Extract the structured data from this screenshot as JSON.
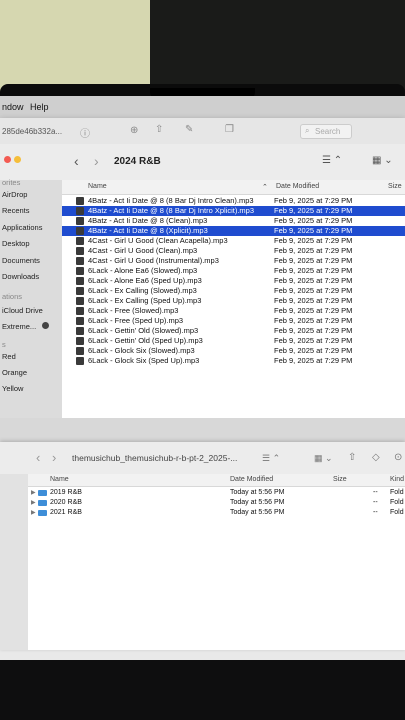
{
  "menubar": {
    "app_item": "ndow",
    "help": "Help"
  },
  "window1": {
    "address_text": "285de46b332a...",
    "search_placeholder": "Search",
    "folder_title": "2024 R&B",
    "sidebar": [
      {
        "label": "orites"
      },
      {
        "label": "AirDrop"
      },
      {
        "label": "Recents"
      },
      {
        "label": "Applications"
      },
      {
        "label": "Desktop"
      },
      {
        "label": "Documents"
      },
      {
        "label": "Downloads"
      },
      {
        "label": "ations"
      },
      {
        "label": "iCloud Drive"
      },
      {
        "label": "Extreme..."
      },
      {
        "label": "s"
      },
      {
        "label": "Red"
      },
      {
        "label": "Orange"
      },
      {
        "label": "Yellow"
      }
    ],
    "columns": {
      "name": "Name",
      "date": "Date Modified",
      "size": "Size"
    },
    "files": [
      {
        "name": "4Batz - Act Ii Date @ 8 (8 Bar Dj Intro Clean).mp3",
        "date": "Feb 9, 2025 at 7:29 PM",
        "selected": false
      },
      {
        "name": "4Batz - Act Ii Date @ 8 (8 Bar Dj Intro Xplicit).mp3",
        "date": "Feb 9, 2025 at 7:29 PM",
        "selected": true
      },
      {
        "name": "4Batz - Act Ii Date @ 8 (Clean).mp3",
        "date": "Feb 9, 2025 at 7:29 PM",
        "selected": false
      },
      {
        "name": "4Batz - Act Ii Date @ 8 (Xplicit).mp3",
        "date": "Feb 9, 2025 at 7:29 PM",
        "selected": true
      },
      {
        "name": "4Cast - Girl U Good (Clean Acapella).mp3",
        "date": "Feb 9, 2025 at 7:29 PM",
        "selected": false
      },
      {
        "name": "4Cast - Girl U Good (Clean).mp3",
        "date": "Feb 9, 2025 at 7:29 PM",
        "selected": false
      },
      {
        "name": "4Cast - Girl U Good (Instrumental).mp3",
        "date": "Feb 9, 2025 at 7:29 PM",
        "selected": false
      },
      {
        "name": "6Lack - Alone Ea6 (Slowed).mp3",
        "date": "Feb 9, 2025 at 7:29 PM",
        "selected": false
      },
      {
        "name": "6Lack - Alone Ea6 (Sped Up).mp3",
        "date": "Feb 9, 2025 at 7:29 PM",
        "selected": false
      },
      {
        "name": "6Lack - Ex Calling (Slowed).mp3",
        "date": "Feb 9, 2025 at 7:29 PM",
        "selected": false
      },
      {
        "name": "6Lack - Ex Calling (Sped Up).mp3",
        "date": "Feb 9, 2025 at 7:29 PM",
        "selected": false
      },
      {
        "name": "6Lack - Free (Slowed).mp3",
        "date": "Feb 9, 2025 at 7:29 PM",
        "selected": false
      },
      {
        "name": "6Lack - Free (Sped Up).mp3",
        "date": "Feb 9, 2025 at 7:29 PM",
        "selected": false
      },
      {
        "name": "6Lack - Gettin' Old (Slowed).mp3",
        "date": "Feb 9, 2025 at 7:29 PM",
        "selected": false
      },
      {
        "name": "6Lack - Gettin' Old (Sped Up).mp3",
        "date": "Feb 9, 2025 at 7:29 PM",
        "selected": false
      },
      {
        "name": "6Lack - Glock Six (Slowed).mp3",
        "date": "Feb 9, 2025 at 7:29 PM",
        "selected": false
      },
      {
        "name": "6Lack - Glock Six (Sped Up).mp3",
        "date": "Feb 9, 2025 at 7:29 PM",
        "selected": false
      }
    ]
  },
  "window2": {
    "folder_title": "themusichub_themusichub-r-b-pt-2_2025-...",
    "columns": {
      "name": "Name",
      "date": "Date Modified",
      "size": "Size",
      "kind": "Kind"
    },
    "folders": [
      {
        "name": "2019 R&B",
        "date": "Today at 5:56 PM",
        "size": "--",
        "kind": "Fold"
      },
      {
        "name": "2020 R&B",
        "date": "Today at 5:56 PM",
        "size": "--",
        "kind": "Fold"
      },
      {
        "name": "2021 R&B",
        "date": "Today at 5:56 PM",
        "size": "--",
        "kind": "Fold"
      }
    ]
  },
  "colors": {
    "selection": "#1f4ccf",
    "folder": "#3e8ed8"
  },
  "dock": {
    "apps": [
      "launchpad-icon",
      "safari-icon",
      "messages-icon",
      "maps-icon",
      "photos-icon",
      "facetime-icon",
      "app-store-icon",
      "settings-icon",
      "chrome-icon",
      "podcasts-icon"
    ]
  }
}
